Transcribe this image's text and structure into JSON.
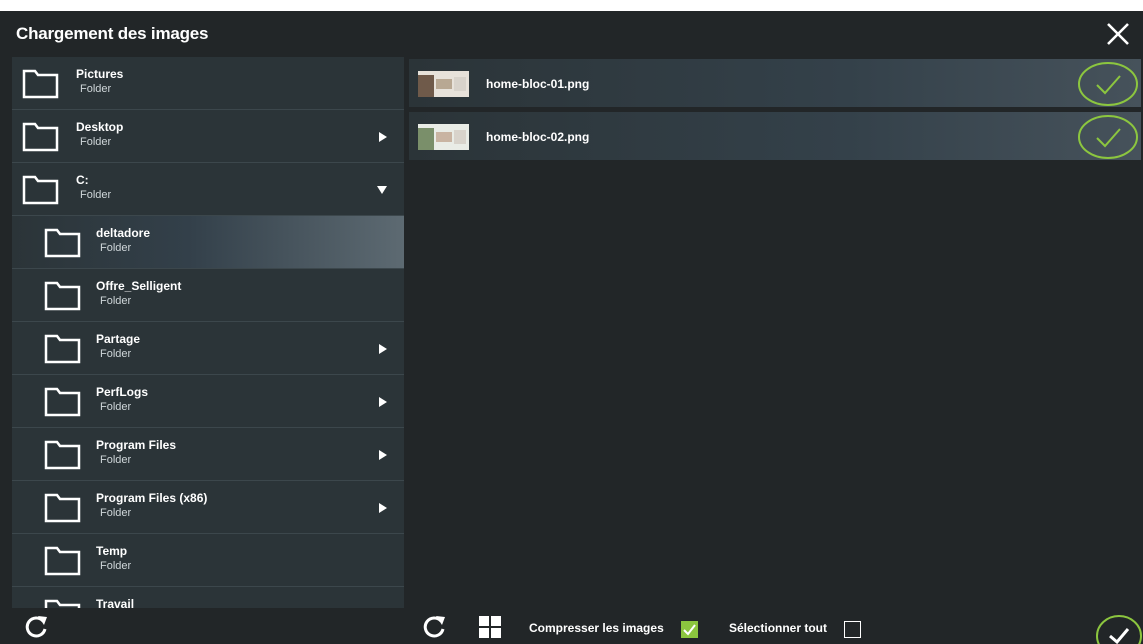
{
  "dialog": {
    "title": "Chargement des images"
  },
  "folders": [
    {
      "name": "Pictures",
      "type": "Folder",
      "arrow": "none",
      "child": false,
      "selected": false
    },
    {
      "name": "Desktop",
      "type": "Folder",
      "arrow": "right",
      "child": false,
      "selected": false
    },
    {
      "name": "C:",
      "type": "Folder",
      "arrow": "down",
      "child": false,
      "selected": false
    },
    {
      "name": "deltadore",
      "type": "Folder",
      "arrow": "none",
      "child": true,
      "selected": true
    },
    {
      "name": "Offre_Selligent",
      "type": "Folder",
      "arrow": "none",
      "child": true,
      "selected": false
    },
    {
      "name": "Partage",
      "type": "Folder",
      "arrow": "right",
      "child": true,
      "selected": false
    },
    {
      "name": "PerfLogs",
      "type": "Folder",
      "arrow": "right",
      "child": true,
      "selected": false
    },
    {
      "name": "Program Files",
      "type": "Folder",
      "arrow": "right",
      "child": true,
      "selected": false
    },
    {
      "name": "Program Files (x86)",
      "type": "Folder",
      "arrow": "right",
      "child": true,
      "selected": false
    },
    {
      "name": "Temp",
      "type": "Folder",
      "arrow": "none",
      "child": true,
      "selected": false
    },
    {
      "name": "Travail",
      "type": "",
      "arrow": "none",
      "child": true,
      "selected": false
    }
  ],
  "files": [
    {
      "name": "home-bloc-01.png",
      "checked": true
    },
    {
      "name": "home-bloc-02.png",
      "checked": true
    }
  ],
  "footer": {
    "compress_label": "Compresser les images",
    "compress_checked": true,
    "select_all_label": "Sélectionner tout",
    "select_all_checked": false
  },
  "colors": {
    "background": "#222628",
    "panel": "#2b3438",
    "accent_green": "#8cc63f"
  },
  "icons": {
    "close": "close-icon",
    "folder": "folder-icon",
    "refresh": "refresh-icon",
    "grid": "grid-view-icon",
    "check": "check-circle-icon"
  }
}
